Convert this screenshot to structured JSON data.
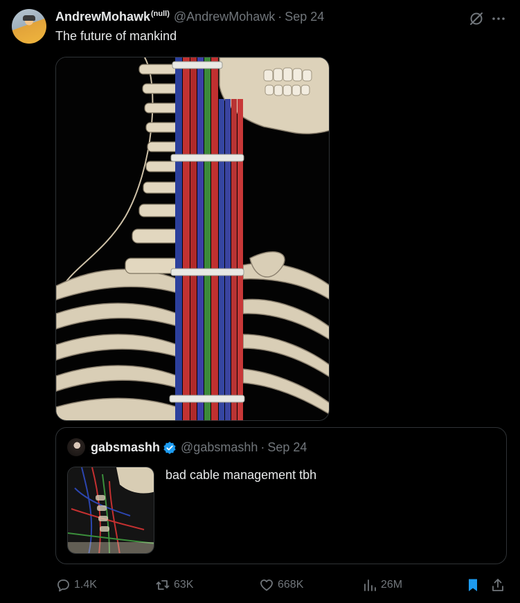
{
  "tweet": {
    "display_name": "AndrewMohawk",
    "name_badge": "(null)",
    "handle": "@AndrewMohawk",
    "separator": "·",
    "date": "Sep 24",
    "text": "The future of mankind"
  },
  "quote": {
    "display_name": "gabsmashh",
    "handle": "@gabsmashh",
    "separator": "·",
    "date": "Sep 24",
    "text": "bad cable management tbh"
  },
  "actions": {
    "replies": "1.4K",
    "reposts": "63K",
    "likes": "668K",
    "views": "26M"
  },
  "icons": {
    "header": [
      "grok-icon",
      "more-icon"
    ],
    "actions": [
      "reply-icon",
      "repost-icon",
      "like-icon",
      "views-icon",
      "bookmark-icon",
      "share-icon"
    ]
  },
  "colors": {
    "background": "#000000",
    "text": "#e7e9ea",
    "muted": "#71767b",
    "border": "#2f3336",
    "verified": "#1d9bf0",
    "bookmark": "#1d9bf0"
  }
}
